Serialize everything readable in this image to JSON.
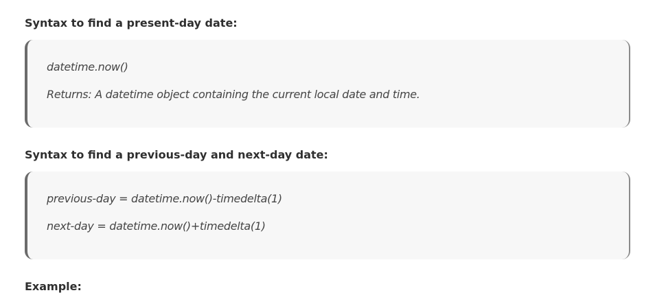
{
  "sections": [
    {
      "heading": "Syntax to find a present-day date:",
      "lines": [
        "datetime.now()",
        "Returns: A datetime object containing the current local date and time."
      ]
    },
    {
      "heading": "Syntax to find a previous-day and next-day date:",
      "lines": [
        "previous-day = datetime.now()-timedelta(1)",
        "next-day = datetime.now()+timedelta(1)"
      ]
    }
  ],
  "example_heading": "Example:"
}
